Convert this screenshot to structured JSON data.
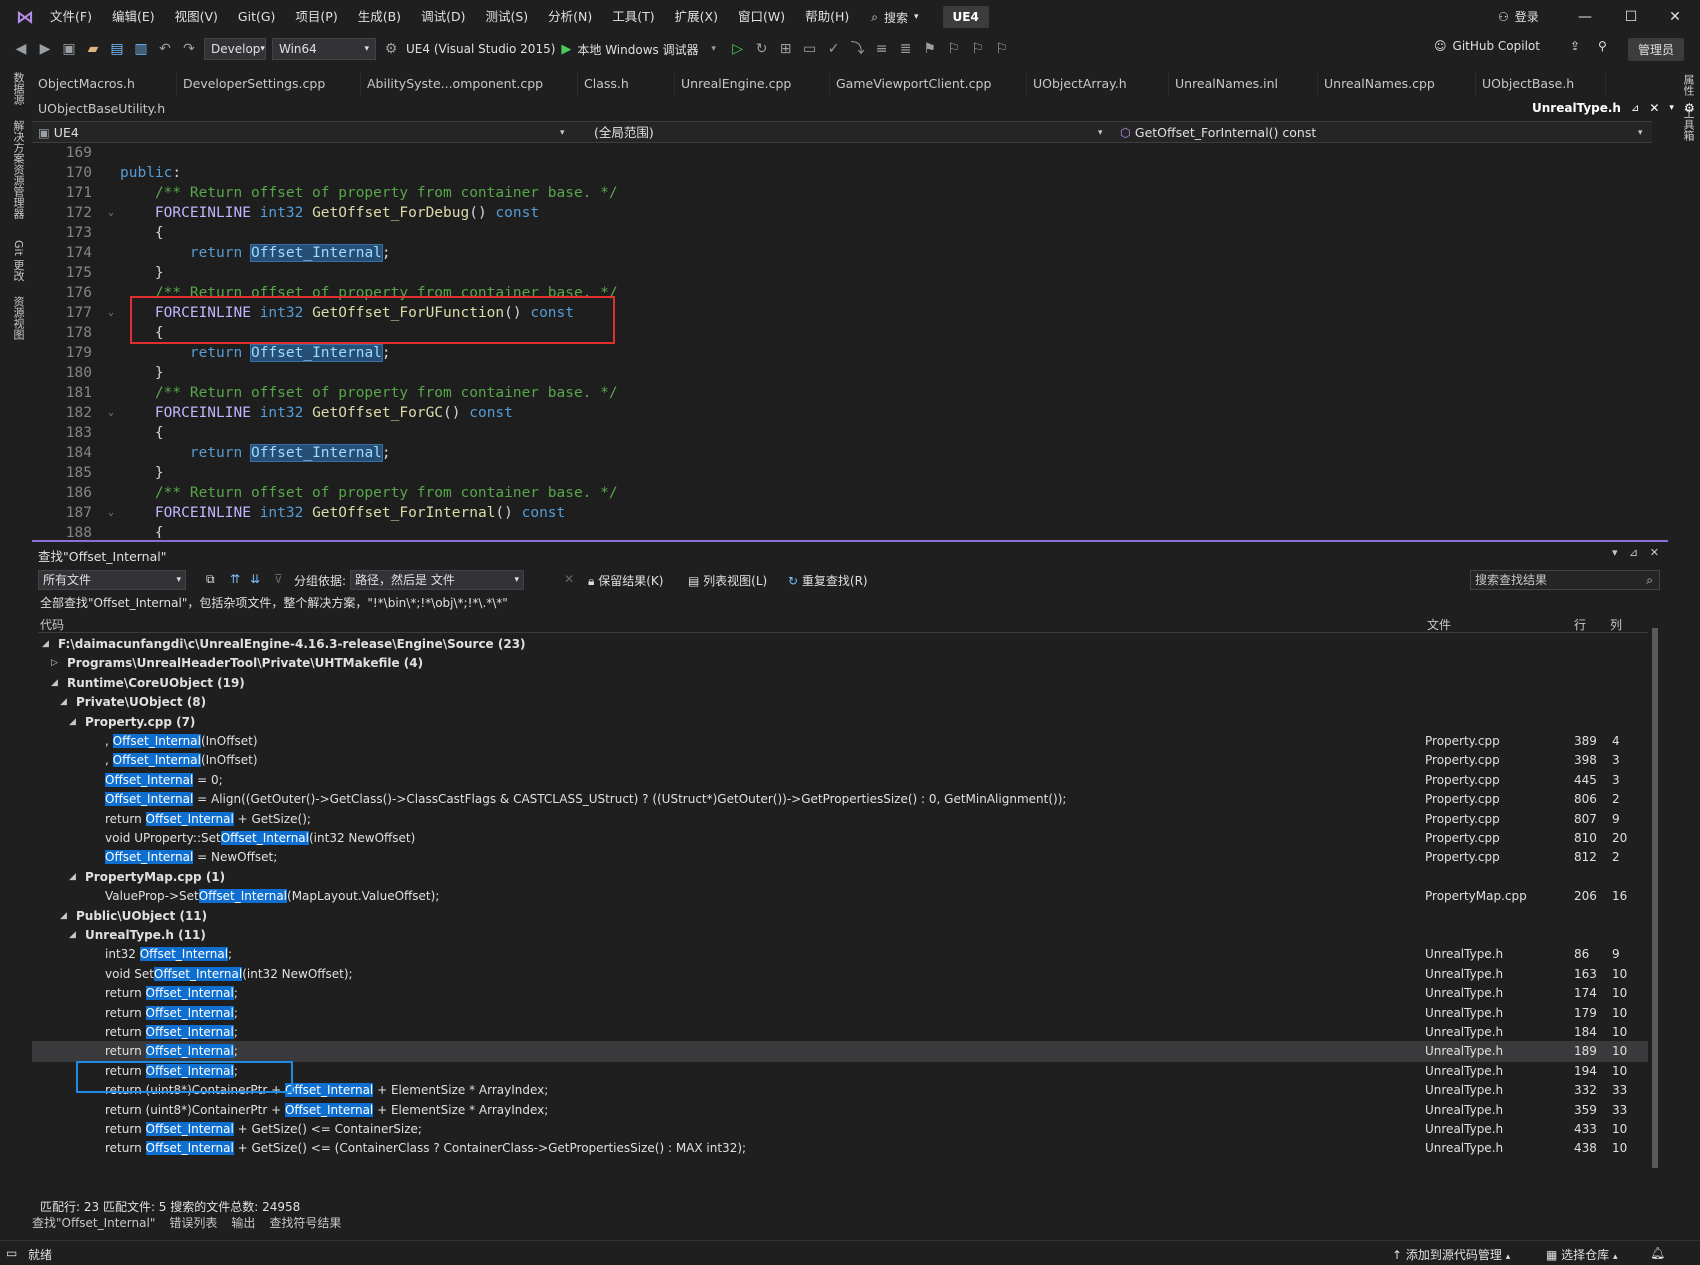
{
  "menubar": {
    "items": [
      "文件(F)",
      "编辑(E)",
      "视图(V)",
      "Git(G)",
      "项目(P)",
      "生成(B)",
      "调试(D)",
      "测试(S)",
      "分析(N)",
      "工具(T)",
      "扩展(X)",
      "窗口(W)",
      "帮助(H)"
    ],
    "search_label": "搜索",
    "solution_name": "UE4",
    "login_label": "登录"
  },
  "toolbar": {
    "config": "Develop",
    "platform": "Win64",
    "startup_project": "UE4 (Visual Studio 2015)",
    "debugger": "本地 Windows 调试器",
    "copilot_label": "GitHub Copilot",
    "admin_label": "管理员"
  },
  "left_rail": [
    "数据源",
    "解决方案资源管理器",
    "Git 更改",
    "资源视图"
  ],
  "right_rail": [
    "属性",
    "工具箱"
  ],
  "tabs_row1": [
    "ObjectMacros.h",
    "DeveloperSettings.cpp",
    "AbilitySyste...omponent.cpp",
    "Class.h",
    "UnrealEngine.cpp",
    "GameViewportClient.cpp",
    "UObjectArray.h",
    "UnrealNames.inl",
    "UnrealNames.cpp",
    "UObjectBase.h"
  ],
  "tabs_row2": [
    "UObjectBaseUtility.h"
  ],
  "active_tab": "UnrealType.h",
  "navbar": {
    "project": "UE4",
    "scope": "(全局范围)",
    "member": "GetOffset_ForInternal() const"
  },
  "editor": {
    "lines": [
      {
        "n": "169",
        "fold": "",
        "code": [
          {
            "t": "pl",
            "s": ""
          }
        ]
      },
      {
        "n": "170",
        "fold": "",
        "code": [
          {
            "t": "kw",
            "s": "public"
          },
          {
            "t": "pl",
            "s": ":"
          }
        ]
      },
      {
        "n": "171",
        "fold": "",
        "code": [
          {
            "t": "pl",
            "s": "    "
          },
          {
            "t": "cm",
            "s": "/** Return offset of property from container base. */"
          }
        ]
      },
      {
        "n": "172",
        "fold": "⌄",
        "code": [
          {
            "t": "pl",
            "s": "    "
          },
          {
            "t": "mac",
            "s": "FORCEINLINE"
          },
          {
            "t": "pl",
            "s": " "
          },
          {
            "t": "kw",
            "s": "int32"
          },
          {
            "t": "pl",
            "s": " "
          },
          {
            "t": "fn",
            "s": "GetOffset_ForDebug"
          },
          {
            "t": "pl",
            "s": "() "
          },
          {
            "t": "kw",
            "s": "const"
          }
        ]
      },
      {
        "n": "173",
        "fold": "",
        "code": [
          {
            "t": "pl",
            "s": "    {"
          }
        ]
      },
      {
        "n": "174",
        "fold": "",
        "code": [
          {
            "t": "pl",
            "s": "        "
          },
          {
            "t": "kw",
            "s": "return"
          },
          {
            "t": "pl",
            "s": " "
          },
          {
            "t": "hl",
            "s": "Offset_Internal"
          },
          {
            "t": "pl",
            "s": ";"
          }
        ]
      },
      {
        "n": "175",
        "fold": "",
        "code": [
          {
            "t": "pl",
            "s": "    }"
          }
        ]
      },
      {
        "n": "176",
        "fold": "",
        "code": [
          {
            "t": "pl",
            "s": "    "
          },
          {
            "t": "cm",
            "s": "/** Return offset of property from container base. */"
          }
        ]
      },
      {
        "n": "177",
        "fold": "⌄",
        "code": [
          {
            "t": "pl",
            "s": "    "
          },
          {
            "t": "mac",
            "s": "FORCEINLINE"
          },
          {
            "t": "pl",
            "s": " "
          },
          {
            "t": "kw",
            "s": "int32"
          },
          {
            "t": "pl",
            "s": " "
          },
          {
            "t": "fn",
            "s": "GetOffset_ForUFunction"
          },
          {
            "t": "pl",
            "s": "() "
          },
          {
            "t": "kw",
            "s": "const"
          }
        ]
      },
      {
        "n": "178",
        "fold": "",
        "code": [
          {
            "t": "pl",
            "s": "    {"
          }
        ]
      },
      {
        "n": "179",
        "fold": "",
        "code": [
          {
            "t": "pl",
            "s": "        "
          },
          {
            "t": "kw",
            "s": "return"
          },
          {
            "t": "pl",
            "s": " "
          },
          {
            "t": "hl",
            "s": "Offset_Internal"
          },
          {
            "t": "pl",
            "s": ";"
          }
        ]
      },
      {
        "n": "180",
        "fold": "",
        "code": [
          {
            "t": "pl",
            "s": "    }"
          }
        ]
      },
      {
        "n": "181",
        "fold": "",
        "code": [
          {
            "t": "pl",
            "s": "    "
          },
          {
            "t": "cm",
            "s": "/** Return offset of property from container base. */"
          }
        ]
      },
      {
        "n": "182",
        "fold": "⌄",
        "code": [
          {
            "t": "pl",
            "s": "    "
          },
          {
            "t": "mac",
            "s": "FORCEINLINE"
          },
          {
            "t": "pl",
            "s": " "
          },
          {
            "t": "kw",
            "s": "int32"
          },
          {
            "t": "pl",
            "s": " "
          },
          {
            "t": "fn",
            "s": "GetOffset_ForGC"
          },
          {
            "t": "pl",
            "s": "() "
          },
          {
            "t": "kw",
            "s": "const"
          }
        ]
      },
      {
        "n": "183",
        "fold": "",
        "code": [
          {
            "t": "pl",
            "s": "    {"
          }
        ]
      },
      {
        "n": "184",
        "fold": "",
        "code": [
          {
            "t": "pl",
            "s": "        "
          },
          {
            "t": "kw",
            "s": "return"
          },
          {
            "t": "pl",
            "s": " "
          },
          {
            "t": "hl",
            "s": "Offset_Internal"
          },
          {
            "t": "pl",
            "s": ";"
          }
        ]
      },
      {
        "n": "185",
        "fold": "",
        "code": [
          {
            "t": "pl",
            "s": "    }"
          }
        ]
      },
      {
        "n": "186",
        "fold": "",
        "code": [
          {
            "t": "pl",
            "s": "    "
          },
          {
            "t": "cm",
            "s": "/** Return offset of property from container base. */"
          }
        ]
      },
      {
        "n": "187",
        "fold": "⌄",
        "code": [
          {
            "t": "pl",
            "s": "    "
          },
          {
            "t": "mac",
            "s": "FORCEINLINE"
          },
          {
            "t": "pl",
            "s": " "
          },
          {
            "t": "kw",
            "s": "int32"
          },
          {
            "t": "pl",
            "s": " "
          },
          {
            "t": "fn",
            "s": "GetOffset_ForInternal"
          },
          {
            "t": "pl",
            "s": "() "
          },
          {
            "t": "kw",
            "s": "const"
          }
        ]
      },
      {
        "n": "188",
        "fold": "",
        "code": [
          {
            "t": "pl",
            "s": "    {"
          }
        ]
      }
    ]
  },
  "find_panel": {
    "title": "查找\"Offset_Internal\"",
    "scope_combo": "所有文件",
    "group_by_label": "分组依据:",
    "group_by_value": "路径，然后是 文件",
    "keep_results": "保留结果(K)",
    "list_view": "列表视图(L)",
    "repeat_find": "重复查找(R)",
    "search_placeholder": "搜索查找结果",
    "summary": "全部查找\"Offset_Internal\"，包括杂项文件，整个解决方案，\"!*\\bin\\*;!*\\obj\\*;!*\\.*\\*\"",
    "col_code": "代码",
    "col_file": "文件",
    "col_line": "行",
    "col_col": "列",
    "rows": [
      {
        "kind": "group",
        "indent": 0,
        "tw": "◢",
        "parts": [
          {
            "s": "F:\\daimacunfangdi\\c\\UnrealEngine-4.16.3-release\\Engine\\Source  (23)"
          }
        ]
      },
      {
        "kind": "group",
        "indent": 1,
        "tw": "▷",
        "parts": [
          {
            "s": "Programs\\UnrealHeaderTool\\Private\\UHTMakefile  (4)"
          }
        ]
      },
      {
        "kind": "group",
        "indent": 1,
        "tw": "◢",
        "parts": [
          {
            "s": "Runtime\\CoreUObject  (19)"
          }
        ]
      },
      {
        "kind": "group",
        "indent": 2,
        "tw": "◢",
        "parts": [
          {
            "s": "Private\\UObject  (8)"
          }
        ]
      },
      {
        "kind": "group",
        "indent": 3,
        "tw": "◢",
        "parts": [
          {
            "s": "Property.cpp  (7)"
          }
        ]
      },
      {
        "kind": "item",
        "parts": [
          {
            "s": ", "
          },
          {
            "s": "Offset_Internal",
            "m": true
          },
          {
            "s": "(InOffset)"
          }
        ],
        "file": "Property.cpp",
        "line": "389",
        "col": "4"
      },
      {
        "kind": "item",
        "parts": [
          {
            "s": ", "
          },
          {
            "s": "Offset_Internal",
            "m": true
          },
          {
            "s": "(InOffset)"
          }
        ],
        "file": "Property.cpp",
        "line": "398",
        "col": "3"
      },
      {
        "kind": "item",
        "parts": [
          {
            "s": "Offset_Internal",
            "m": true
          },
          {
            "s": " = 0;"
          }
        ],
        "file": "Property.cpp",
        "line": "445",
        "col": "3"
      },
      {
        "kind": "item",
        "parts": [
          {
            "s": "Offset_Internal",
            "m": true
          },
          {
            "s": " = Align((GetOuter()->GetClass()->ClassCastFlags & CASTCLASS_UStruct) ? ((UStruct*)GetOuter())->GetPropertiesSize() : 0, GetMinAlignment());"
          }
        ],
        "file": "Property.cpp",
        "line": "806",
        "col": "2"
      },
      {
        "kind": "item",
        "parts": [
          {
            "s": "return "
          },
          {
            "s": "Offset_Internal",
            "m": true
          },
          {
            "s": " + GetSize();"
          }
        ],
        "file": "Property.cpp",
        "line": "807",
        "col": "9"
      },
      {
        "kind": "item",
        "parts": [
          {
            "s": "void UProperty::Set"
          },
          {
            "s": "Offset_Internal",
            "m": true
          },
          {
            "s": "(int32 NewOffset)"
          }
        ],
        "file": "Property.cpp",
        "line": "810",
        "col": "20"
      },
      {
        "kind": "item",
        "parts": [
          {
            "s": "Offset_Internal",
            "m": true
          },
          {
            "s": " = NewOffset;"
          }
        ],
        "file": "Property.cpp",
        "line": "812",
        "col": "2"
      },
      {
        "kind": "group",
        "indent": 3,
        "tw": "◢",
        "parts": [
          {
            "s": "PropertyMap.cpp  (1)"
          }
        ]
      },
      {
        "kind": "item",
        "parts": [
          {
            "s": "ValueProp->Set"
          },
          {
            "s": "Offset_Internal",
            "m": true
          },
          {
            "s": "(MapLayout.ValueOffset);"
          }
        ],
        "file": "PropertyMap.cpp",
        "line": "206",
        "col": "16"
      },
      {
        "kind": "group",
        "indent": 2,
        "tw": "◢",
        "parts": [
          {
            "s": "Public\\UObject  (11)"
          }
        ]
      },
      {
        "kind": "group",
        "indent": 3,
        "tw": "◢",
        "parts": [
          {
            "s": "UnrealType.h  (11)"
          }
        ]
      },
      {
        "kind": "item",
        "parts": [
          {
            "s": "int32       "
          },
          {
            "s": "Offset_Internal",
            "m": true
          },
          {
            "s": ";"
          }
        ],
        "file": "UnrealType.h",
        "line": "86",
        "col": "9"
      },
      {
        "kind": "item",
        "parts": [
          {
            "s": "void Set"
          },
          {
            "s": "Offset_Internal",
            "m": true
          },
          {
            "s": "(int32 NewOffset);"
          }
        ],
        "file": "UnrealType.h",
        "line": "163",
        "col": "10"
      },
      {
        "kind": "item",
        "parts": [
          {
            "s": "return "
          },
          {
            "s": "Offset_Internal",
            "m": true
          },
          {
            "s": ";"
          }
        ],
        "file": "UnrealType.h",
        "line": "174",
        "col": "10"
      },
      {
        "kind": "item",
        "parts": [
          {
            "s": "return "
          },
          {
            "s": "Offset_Internal",
            "m": true
          },
          {
            "s": ";"
          }
        ],
        "file": "UnrealType.h",
        "line": "179",
        "col": "10"
      },
      {
        "kind": "item",
        "parts": [
          {
            "s": "return "
          },
          {
            "s": "Offset_Internal",
            "m": true
          },
          {
            "s": ";"
          }
        ],
        "file": "UnrealType.h",
        "line": "184",
        "col": "10"
      },
      {
        "kind": "item",
        "selected": true,
        "parts": [
          {
            "s": "return "
          },
          {
            "s": "Offset_Internal",
            "m": true
          },
          {
            "s": ";"
          }
        ],
        "file": "UnrealType.h",
        "line": "189",
        "col": "10"
      },
      {
        "kind": "item",
        "parts": [
          {
            "s": "return "
          },
          {
            "s": "Offset_Internal",
            "m": true
          },
          {
            "s": ";"
          }
        ],
        "file": "UnrealType.h",
        "line": "194",
        "col": "10"
      },
      {
        "kind": "item",
        "parts": [
          {
            "s": "return (uint8*)ContainerPtr + "
          },
          {
            "s": "Offset_Internal",
            "m": true
          },
          {
            "s": " + ElementSize * ArrayIndex;"
          }
        ],
        "file": "UnrealType.h",
        "line": "332",
        "col": "33"
      },
      {
        "kind": "item",
        "parts": [
          {
            "s": "return (uint8*)ContainerPtr + "
          },
          {
            "s": "Offset_Internal",
            "m": true
          },
          {
            "s": " + ElementSize * ArrayIndex;"
          }
        ],
        "file": "UnrealType.h",
        "line": "359",
        "col": "33"
      },
      {
        "kind": "item",
        "parts": [
          {
            "s": "return "
          },
          {
            "s": "Offset_Internal",
            "m": true
          },
          {
            "s": " + GetSize() <= ContainerSize;"
          }
        ],
        "file": "UnrealType.h",
        "line": "433",
        "col": "10"
      },
      {
        "kind": "item",
        "parts": [
          {
            "s": "return "
          },
          {
            "s": "Offset_Internal",
            "m": true
          },
          {
            "s": " + GetSize() <= (ContainerClass ? ContainerClass->GetPropertiesSize() : MAX int32);"
          }
        ],
        "file": "UnrealType.h",
        "line": "438",
        "col": "10"
      }
    ],
    "stats": "匹配行: 23 匹配文件: 5 搜索的文件总数: 24958"
  },
  "bottom_tabs": [
    "查找\"Offset_Internal\"",
    "错误列表",
    "输出",
    "查找符号结果"
  ],
  "statusbar": {
    "ready": "就绪",
    "add_source_control": "添加到源代码管理",
    "select_repo": "选择仓库"
  },
  "colors": {
    "accent": "#8b6fd6",
    "match_highlight": "#0e6fd1",
    "annotation_red": "#e03030",
    "annotation_blue": "#1e8be6"
  }
}
